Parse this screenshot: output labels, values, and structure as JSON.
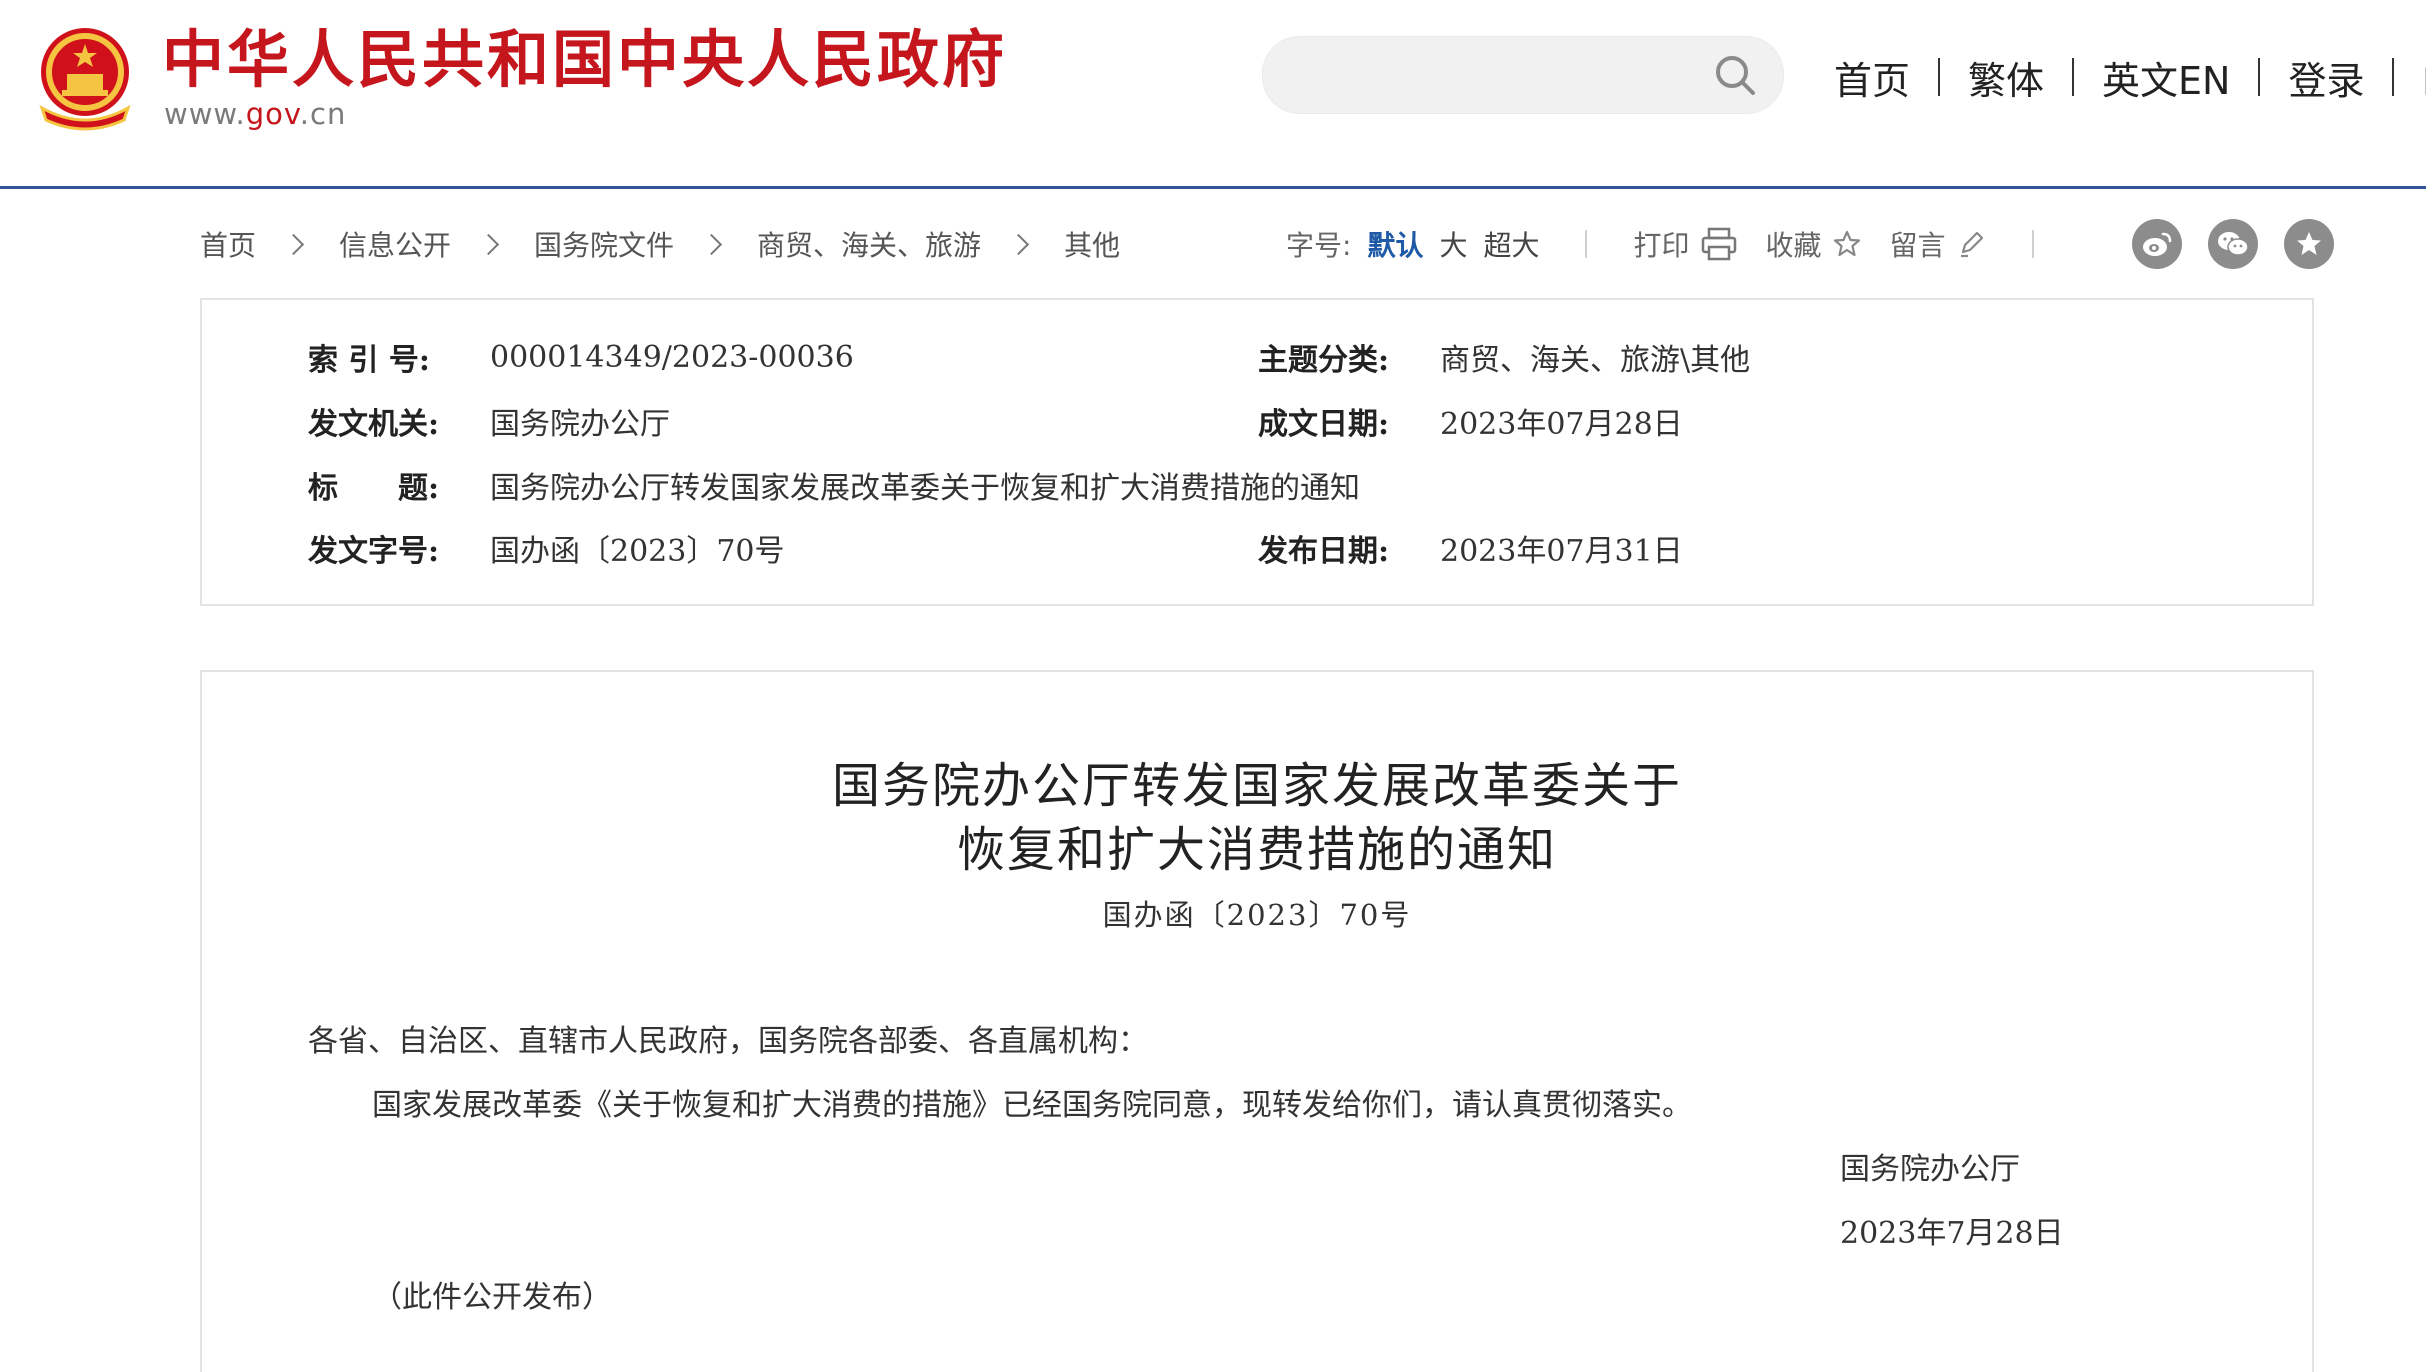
{
  "header": {
    "site_title": "中华人民共和国中央人民政府",
    "domain_prefix": "www.",
    "domain_accent": "gov",
    "domain_suffix": ".cn",
    "search_placeholder": "",
    "nav": [
      "首页",
      "繁体",
      "英文EN",
      "登录",
      "邮"
    ],
    "accent_color": "#c4161c",
    "rule_color": "#2f5597"
  },
  "breadcrumb": [
    "首页",
    "信息公开",
    "国务院文件",
    "商贸、海关、旅游",
    "其他"
  ],
  "tools": {
    "font_size_label": "字号:",
    "font_sizes": [
      "默认",
      "大",
      "超大"
    ],
    "active_font_size": "默认",
    "print": "打印",
    "favorite": "收藏",
    "comment": "留言",
    "share_icons": [
      "weibo-icon",
      "wechat-icon",
      "favorite-star-icon"
    ]
  },
  "meta": {
    "index_label": "索 引 号:",
    "index_value": "000014349/2023-00036",
    "topic_label": "主题分类:",
    "topic_value": "商贸、海关、旅游\\其他",
    "issuer_label": "发文机关:",
    "issuer_value": "国务院办公厅",
    "written_label": "成文日期:",
    "written_value": "2023年07月28日",
    "title_label": "标　　题:",
    "title_value": "国务院办公厅转发国家发展改革委关于恢复和扩大消费措施的通知",
    "docno_label": "发文字号:",
    "docno_value": "国办函〔2023〕70号",
    "published_label": "发布日期:",
    "published_value": "2023年07月31日"
  },
  "article": {
    "title_line1": "国务院办公厅转发国家发展改革委关于",
    "title_line2": "恢复和扩大消费措施的通知",
    "doc_number": "国办函〔2023〕70号",
    "salutation": "各省、自治区、直辖市人民政府，国务院各部委、各直属机构：",
    "body": "国家发展改革委《关于恢复和扩大消费的措施》已经国务院同意，现转发给你们，请认真贯彻落实。",
    "signature": "国务院办公厅",
    "date": "2023年7月28日",
    "note": "（此件公开发布）"
  }
}
